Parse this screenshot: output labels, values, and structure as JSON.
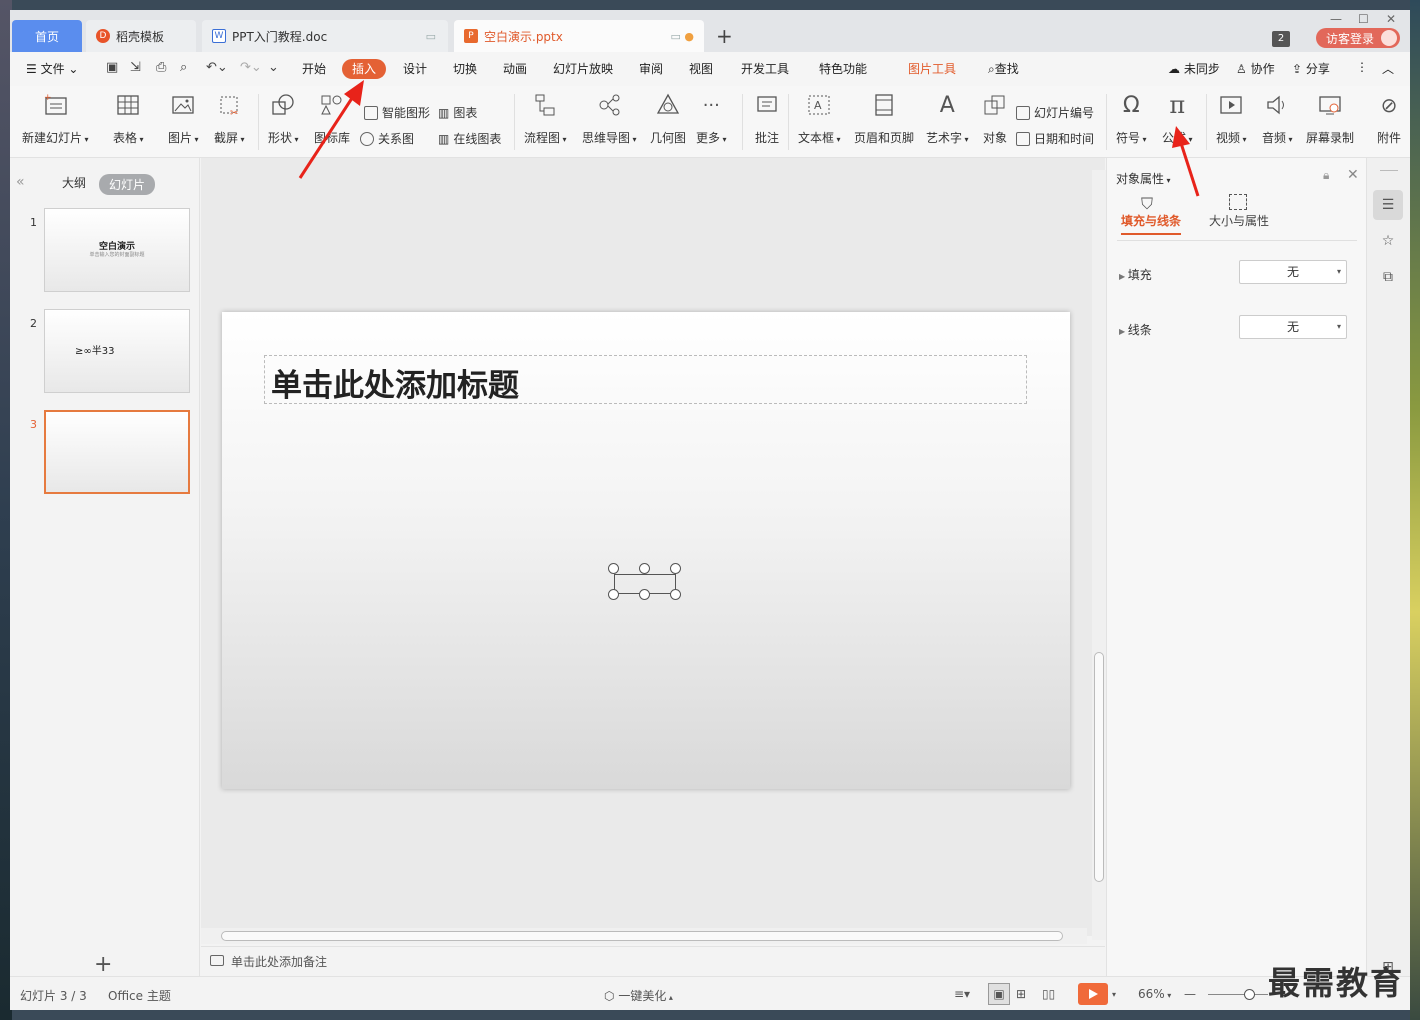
{
  "tabs": {
    "home": "首页",
    "daoke": "稻壳模板",
    "doc": "PPT入门教程.doc",
    "ppt": "空白演示.pptx",
    "plus": "+"
  },
  "titlebar": {
    "window_count": "2",
    "login": "访客登录"
  },
  "menu": {
    "file": "文件",
    "start": "开始",
    "insert": "插入",
    "design": "设计",
    "switch": "切换",
    "animation": "动画",
    "slideshow": "幻灯片放映",
    "review": "审阅",
    "view": "视图",
    "devtools": "开发工具",
    "special": "特色功能",
    "picture_tools": "图片工具",
    "search": "查找",
    "sync": "未同步",
    "collab": "协作",
    "share": "分享"
  },
  "ribbon": {
    "new_slide": "新建幻灯片",
    "table": "表格",
    "picture": "图片",
    "screenshot": "截屏",
    "shape": "形状",
    "icon_lib": "图标库",
    "smart_shape": "智能图形",
    "relation": "关系图",
    "chart": "图表",
    "online_chart": "在线图表",
    "flowchart": "流程图",
    "mindmap": "思维导图",
    "geometry": "几何图",
    "more": "更多",
    "comment": "批注",
    "textbox": "文本框",
    "header_footer": "页眉和页脚",
    "wordart": "艺术字",
    "object": "对象",
    "slide_number": "幻灯片编号",
    "datetime": "日期和时间",
    "symbol": "符号",
    "formula": "公式",
    "video": "视频",
    "audio": "音频",
    "screen_record": "屏幕录制",
    "attachment": "附件"
  },
  "left_panel": {
    "outline_tab": "大纲",
    "slides_tab": "幻灯片",
    "slides": [
      {
        "num": "1",
        "title": "空白演示",
        "subtitle": "单击输入您的封面副标题"
      },
      {
        "num": "2",
        "text": "≥∞半33"
      },
      {
        "num": "3"
      }
    ]
  },
  "slide": {
    "title_placeholder": "单击此处添加标题"
  },
  "notes": {
    "placeholder": "单击此处添加备注"
  },
  "properties": {
    "title": "对象属性",
    "tab_fill": "填充与线条",
    "tab_size": "大小与属性",
    "fill_label": "填充",
    "fill_value": "无",
    "line_label": "线条",
    "line_value": "无"
  },
  "statusbar": {
    "slide_count": "幻灯片 3 / 3",
    "theme": "Office 主题",
    "beautify": "一键美化",
    "zoom": "66%"
  },
  "watermark": "最需教育",
  "colors": {
    "accent": "#e46135",
    "home_tab": "#5a8dee",
    "selected_border": "#e67a3f"
  }
}
